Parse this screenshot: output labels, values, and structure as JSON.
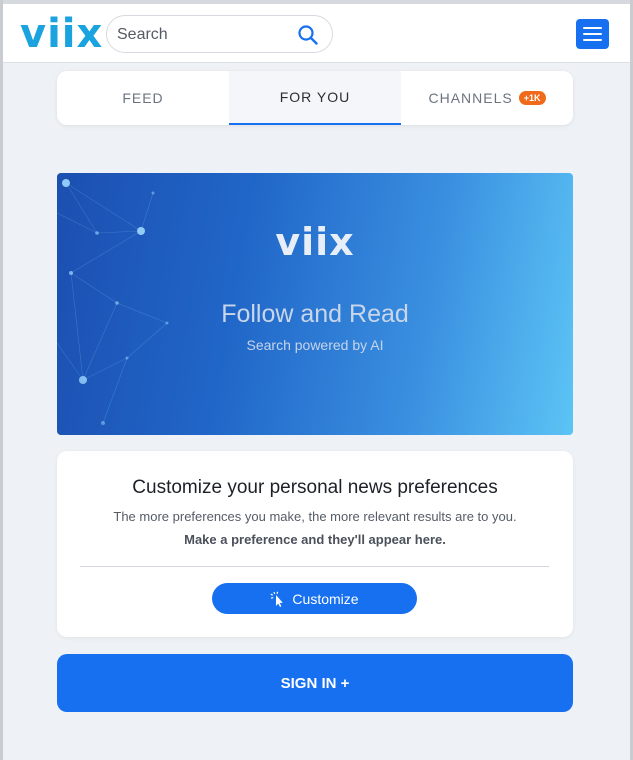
{
  "header": {
    "logo_text": "viix",
    "search_placeholder": "Search",
    "menu_icon": "hamburger-menu-icon"
  },
  "tabs": [
    {
      "label": "FEED",
      "active": false
    },
    {
      "label": "FOR YOU",
      "active": true
    },
    {
      "label": "CHANNELS",
      "active": false,
      "badge": "+1K"
    }
  ],
  "banner": {
    "logo_text": "viix",
    "title": "Follow and Read",
    "subtitle": "Search powered by AI"
  },
  "preferences_card": {
    "title": "Customize your personal news preferences",
    "description": "The more preferences you make, the more relevant results are to you.",
    "hint": "Make a preference and they'll appear here.",
    "button_label": "Customize",
    "button_icon": "pointer-click-icon"
  },
  "signin": {
    "label": "SIGN IN +"
  },
  "colors": {
    "brand": "#1aa3de",
    "accent": "#1670f0",
    "badge": "#f06a1b",
    "background": "#eef1f5"
  }
}
